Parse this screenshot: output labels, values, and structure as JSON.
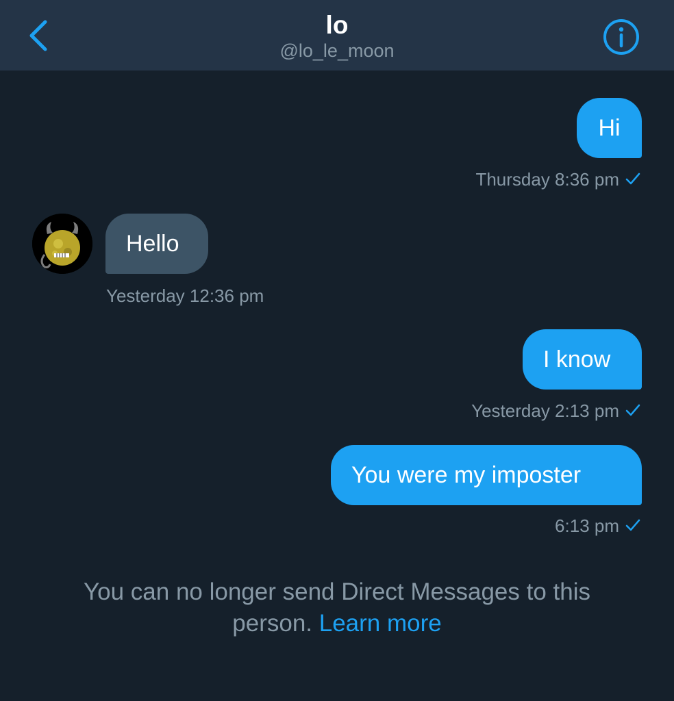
{
  "header": {
    "title": "lo",
    "handle": "@lo_le_moon",
    "back_icon": "chevron-left-icon",
    "info_icon": "info-circle-icon"
  },
  "colors": {
    "background": "#15202b",
    "header_bg": "#243447",
    "accent": "#1da1f2",
    "received_bubble": "#3d5466",
    "muted_text": "#8899a6"
  },
  "messages": [
    {
      "text": "Hi",
      "timestamp": "Thursday 8:36 pm",
      "direction": "sent",
      "read": true
    },
    {
      "text": "Hello",
      "timestamp": "Yesterday 12:36 pm",
      "direction": "received",
      "read": false
    },
    {
      "text": "I know",
      "timestamp": "Yesterday 2:13 pm",
      "direction": "sent",
      "read": true
    },
    {
      "text": "You were my imposter",
      "timestamp": "6:13 pm",
      "direction": "sent",
      "read": true
    }
  ],
  "notice": {
    "text": "You can no longer send Direct Messages to this person.",
    "link": "Learn more"
  }
}
